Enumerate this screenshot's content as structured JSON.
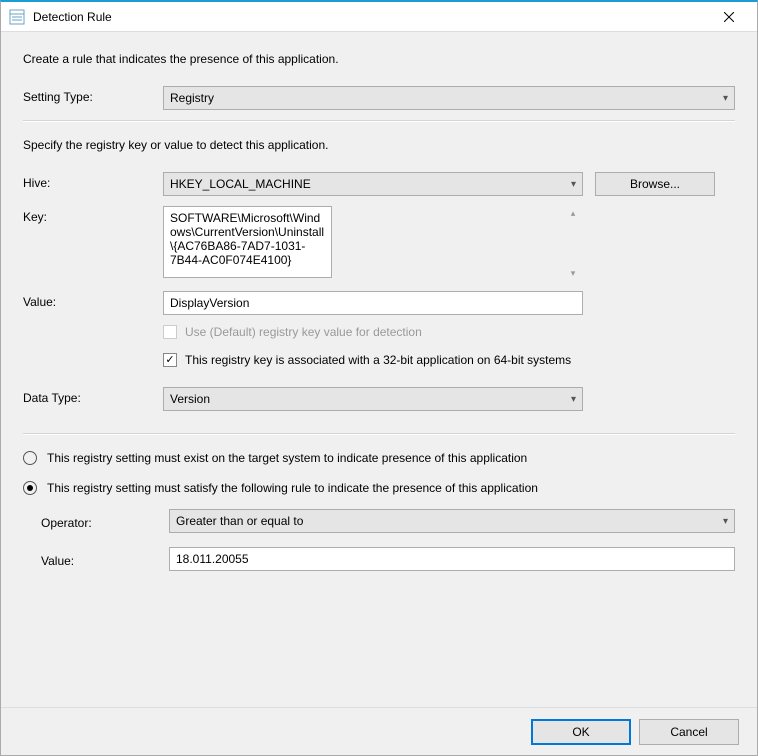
{
  "window": {
    "title": "Detection Rule"
  },
  "intro": "Create a rule that indicates the presence of this application.",
  "setting_type": {
    "label": "Setting Type:",
    "value": "Registry"
  },
  "registry_section": {
    "intro": "Specify the registry key or value to detect this application.",
    "hive": {
      "label": "Hive:",
      "value": "HKEY_LOCAL_MACHINE",
      "browse": "Browse..."
    },
    "key": {
      "label": "Key:",
      "value": "SOFTWARE\\Microsoft\\Windows\\CurrentVersion\\Uninstall\\{AC76BA86-7AD7-1031-7B44-AC0F074E4100}"
    },
    "value_field": {
      "label": "Value:",
      "value": "DisplayVersion"
    },
    "use_default": {
      "label": "Use (Default) registry key value for detection",
      "checked": false
    },
    "is_32bit": {
      "label": "This registry key is associated with a 32-bit application on 64-bit systems",
      "checked": true
    },
    "data_type": {
      "label": "Data Type:",
      "value": "Version"
    }
  },
  "rule_mode": {
    "option_exists": "This registry setting must exist on the target system to indicate presence of this application",
    "option_satisfy": "This registry setting must satisfy the following rule to indicate the presence of this application",
    "selected": "satisfy"
  },
  "rule": {
    "operator": {
      "label": "Operator:",
      "value": "Greater than or equal to"
    },
    "value": {
      "label": "Value:",
      "value": "18.011.20055"
    }
  },
  "footer": {
    "ok": "OK",
    "cancel": "Cancel"
  }
}
